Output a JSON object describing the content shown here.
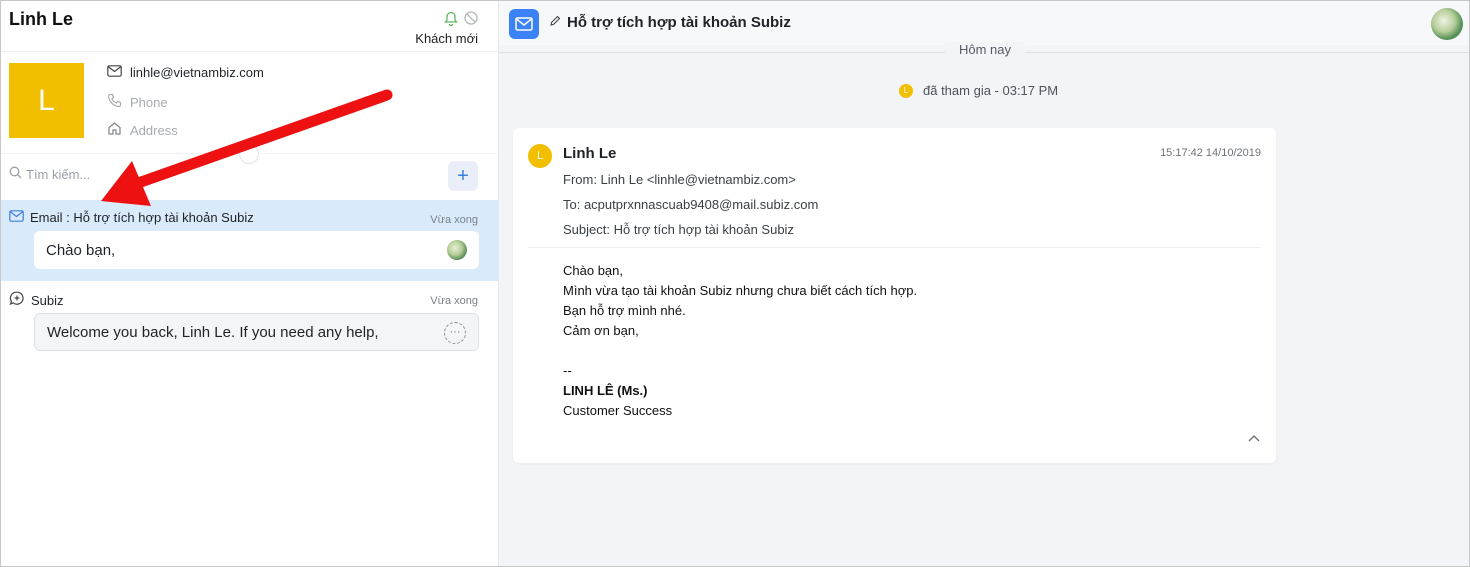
{
  "contact": {
    "name": "Linh Le",
    "status_label": "Khách mới",
    "avatar_letter": "L",
    "email": "linhle@vietnambiz.com",
    "phone_placeholder": "Phone",
    "address_placeholder": "Address"
  },
  "search": {
    "placeholder": "Tìm kiếm..."
  },
  "conversations": [
    {
      "title": "Email : Hỗ trợ tích hợp tài khoản Subiz",
      "time": "Vừa xong",
      "preview": "Chào bạn,",
      "icon": "mail-icon"
    },
    {
      "title": "Subiz",
      "time": "Vừa xong",
      "preview": "Welcome you back, Linh Le. If you need any help,",
      "icon": "chat-plus-icon"
    }
  ],
  "header": {
    "title": "Hỗ trợ tích hợp tài khoản Subiz"
  },
  "timeline": {
    "day_label": "Hôm nay",
    "joined_text": "đã tham gia - 03:17 PM",
    "joined_avatar_letter": "L"
  },
  "email": {
    "avatar_letter": "L",
    "sender": "Linh Le",
    "timestamp": "15:17:42 14/10/2019",
    "from": "From: Linh Le <linhle@vietnambiz.com>",
    "to": "To: acputprxnnascuab9408@mail.subiz.com",
    "subject": "Subject: Hỗ trợ tích hợp tài khoản Subiz",
    "body": [
      "Chào bạn,",
      "Mình vừa tạo tài khoản Subiz nhưng chưa biết cách tích hợp.",
      "Bạn hỗ trợ mình nhé.",
      "Cảm ơn bạn,",
      "",
      "--"
    ],
    "signature_name": "LINH LÊ (Ms.)",
    "signature_title": "Customer Success"
  },
  "colors": {
    "accent": "#3b82f6",
    "avatar": "#f2be00",
    "active_row": "#d9eafb",
    "annotation_arrow": "#ee1111"
  }
}
